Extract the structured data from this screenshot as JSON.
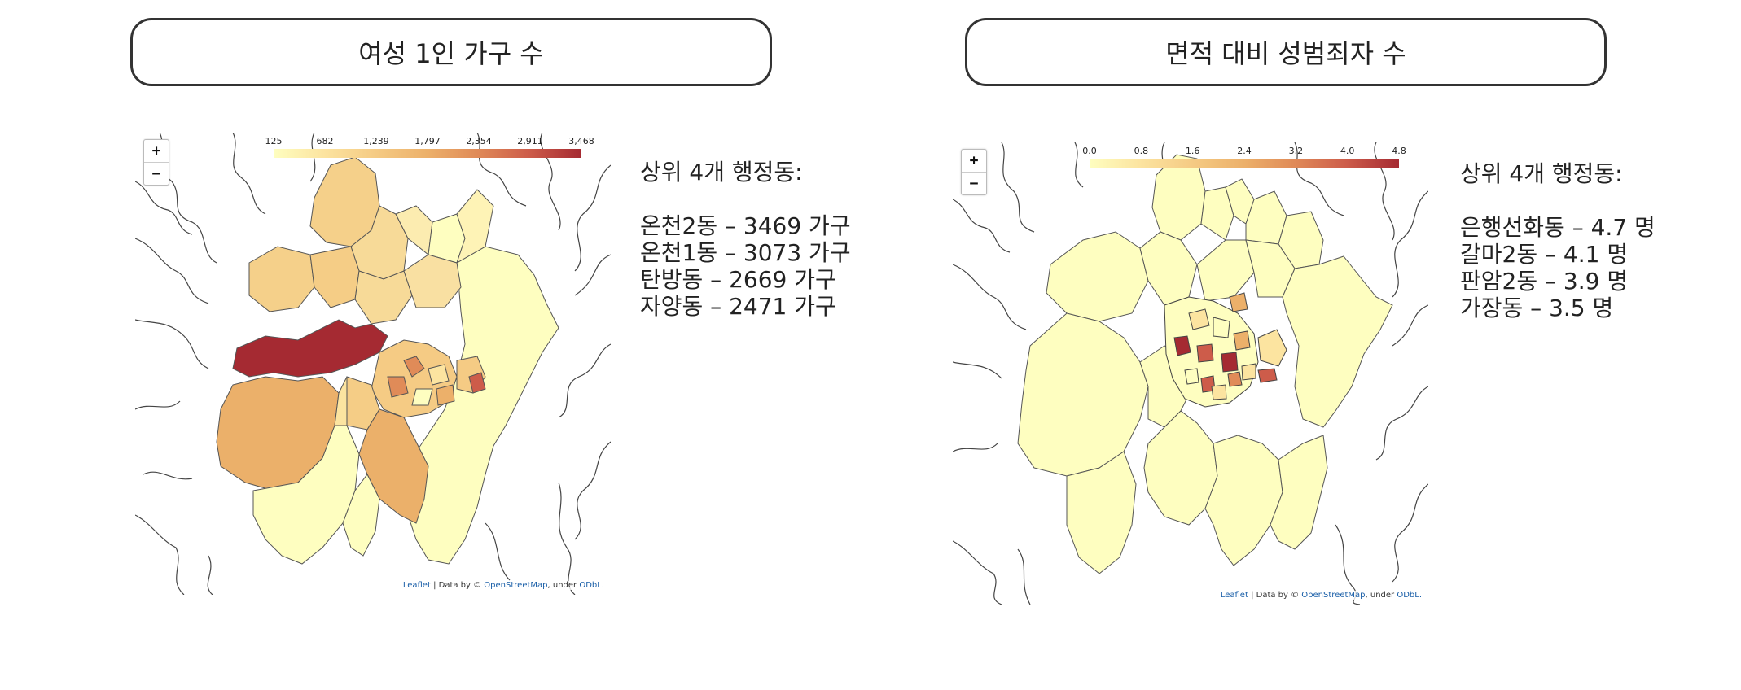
{
  "panels": [
    {
      "title": "여성 1인 가구 수",
      "legend": {
        "ticks": [
          "125",
          "682",
          "1,239",
          "1,797",
          "2,354",
          "2,911",
          "3,468"
        ],
        "colors": [
          "#fefec0",
          "#fce4a0",
          "#f5cb84",
          "#ecb06a",
          "#e08b58",
          "#cd5c4a",
          "#a52a32"
        ]
      },
      "heading": "상위 4개 행정동:",
      "ranking": [
        "온천2동 – 3469 가구",
        "온천1동 – 3073 가구",
        "탄방동 – 2669 가구",
        "자양동 – 2471 가구"
      ]
    },
    {
      "title": "면적 대비 성범죄자 수",
      "legend": {
        "ticks": [
          "0.0",
          "0.8",
          "1.6",
          "2.4",
          "3.2",
          "4.0",
          "4.8"
        ],
        "colors": [
          "#fefec0",
          "#fce4a0",
          "#f5cb84",
          "#ecb06a",
          "#e08b58",
          "#cd5c4a",
          "#a52a32"
        ]
      },
      "heading": "상위 4개 행정동:",
      "ranking": [
        "은행선화동 – 4.7 명",
        "갈마2동 – 4.1 명",
        "판암2동 – 3.9 명",
        "가장동 – 3.5 명"
      ]
    }
  ],
  "map_controls": {
    "zoom_in": "+",
    "zoom_out": "−"
  },
  "attribution": {
    "leaflet": "Leaflet",
    "sep": " | Data by © ",
    "osm": "OpenStreetMap",
    "under": ", under ",
    "odbl": "ODbL."
  }
}
